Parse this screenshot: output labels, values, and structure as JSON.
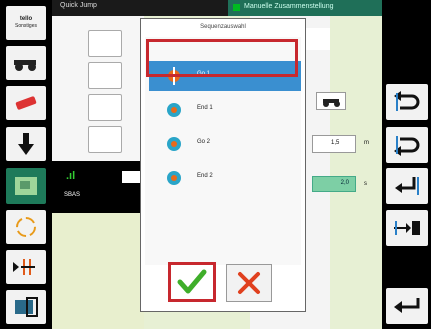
{
  "topbar": {
    "quickjump_label": "Quick Jump",
    "assembly_title": "Manuelle Zusammenstellung"
  },
  "status": {
    "gps_label": "SBAS"
  },
  "left_toolbar": {
    "logo_text": "tello",
    "logo_sub": "Sonstiges"
  },
  "dialog": {
    "title": "Sequenzauswahl",
    "items": [
      {
        "label": "Go 1",
        "selected": true
      },
      {
        "label": "End 1",
        "selected": false
      },
      {
        "label": "Go 2",
        "selected": false
      },
      {
        "label": "End 2",
        "selected": false
      }
    ],
    "confirm_icon": "checkmark-icon",
    "cancel_icon": "cross-icon"
  },
  "right_panel": {
    "value_1": "1,5",
    "unit_1": "m",
    "value_2": "2,0",
    "unit_2": "s"
  },
  "colors": {
    "selection": "#3a8fd0",
    "highlight_frame": "#c7282e",
    "confirm": "#3fae2a",
    "cancel": "#e0401e",
    "header_green": "#1f6f58"
  }
}
